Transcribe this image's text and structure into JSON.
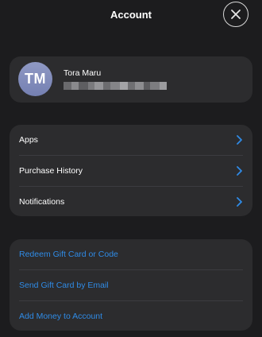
{
  "header": {
    "title": "Account",
    "close_icon": "close-icon"
  },
  "profile": {
    "initials": "TM",
    "name": "Tora Maru",
    "avatar_color": "#7f89ba"
  },
  "menu_main": {
    "items": [
      {
        "label": "Apps",
        "icon": "chevron-right-icon"
      },
      {
        "label": "Purchase History",
        "icon": "chevron-right-icon"
      },
      {
        "label": "Notifications",
        "icon": "chevron-right-icon"
      }
    ]
  },
  "menu_wallet": {
    "items": [
      {
        "label": "Redeem Gift Card or Code"
      },
      {
        "label": "Send Gift Card by Email"
      },
      {
        "label": "Add Money to Account"
      }
    ]
  },
  "colors": {
    "background": "#1c1c1e",
    "card": "#2c2c2e",
    "accent": "#2f8be6"
  }
}
